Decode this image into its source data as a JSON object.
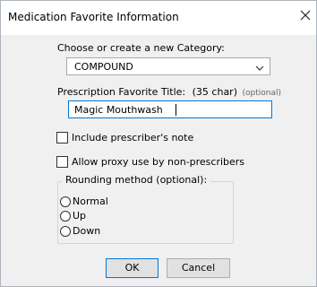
{
  "dialog": {
    "title": "Medication Favorite Information",
    "close_icon": "close-icon"
  },
  "category": {
    "label": "Choose or create a new Category:",
    "selected": "COMPOUND"
  },
  "favorite_title": {
    "label": "Prescription Favorite Title:",
    "limit": "(35 char)",
    "optional": "(optional)",
    "value": "Magic Mouthwash"
  },
  "options": {
    "prescriber_note": "Include prescriber's note",
    "proxy_use": "Allow proxy use by non-prescribers"
  },
  "rounding": {
    "legend": "Rounding method (optional):",
    "choices": [
      "Normal",
      "Up",
      "Down"
    ]
  },
  "buttons": {
    "ok": "OK",
    "cancel": "Cancel"
  }
}
